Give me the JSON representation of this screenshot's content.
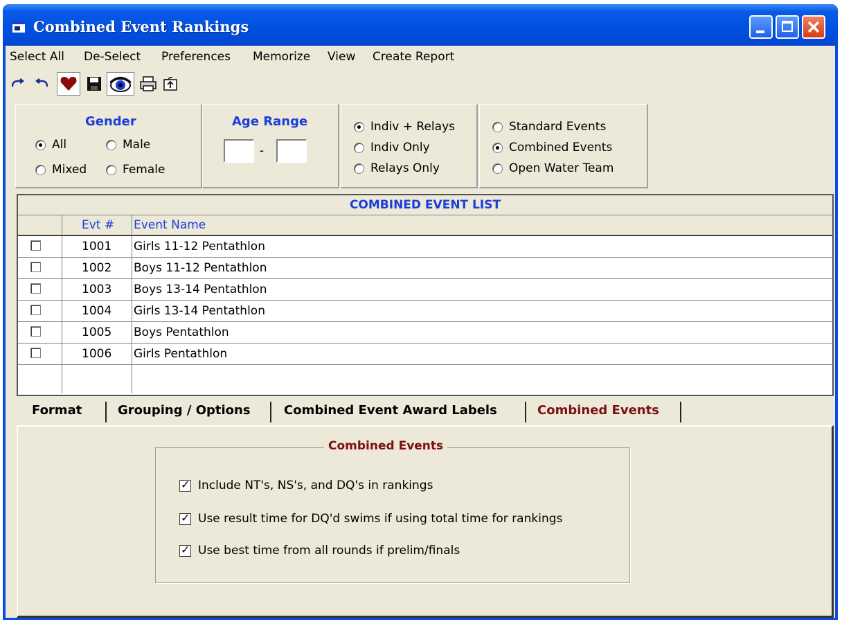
{
  "window": {
    "title": "Combined Event Rankings"
  },
  "menu": [
    "Select All",
    "De-Select",
    "Preferences",
    "Memorize",
    "View",
    "Create Report"
  ],
  "toolbar": [
    {
      "name": "redo-icon"
    },
    {
      "name": "undo-icon"
    },
    {
      "name": "heart-icon"
    },
    {
      "name": "save-icon"
    },
    {
      "name": "eye-icon"
    },
    {
      "name": "print-icon"
    },
    {
      "name": "export-icon"
    }
  ],
  "gender": {
    "label": "Gender",
    "options": [
      {
        "label": "All",
        "selected": true
      },
      {
        "label": "Male",
        "selected": false
      },
      {
        "label": "Mixed",
        "selected": false
      },
      {
        "label": "Female",
        "selected": false
      }
    ]
  },
  "age_range": {
    "label": "Age Range",
    "from": "",
    "to": "",
    "separator": "-"
  },
  "event_type": {
    "options": [
      {
        "label": "Indiv + Relays",
        "selected": true
      },
      {
        "label": "Indiv Only",
        "selected": false
      },
      {
        "label": "Relays Only",
        "selected": false
      }
    ]
  },
  "event_category": {
    "options": [
      {
        "label": "Standard Events",
        "selected": false
      },
      {
        "label": "Combined Events",
        "selected": true
      },
      {
        "label": "Open Water Team",
        "selected": false
      }
    ]
  },
  "event_list": {
    "title": "COMBINED EVENT LIST",
    "columns": [
      "",
      "Evt #",
      "Event Name"
    ],
    "rows": [
      {
        "checked": false,
        "evt": "1001",
        "name": "Girls 11-12 Pentathlon"
      },
      {
        "checked": false,
        "evt": "1002",
        "name": "Boys 11-12 Pentathlon"
      },
      {
        "checked": false,
        "evt": "1003",
        "name": "Boys 13-14 Pentathlon"
      },
      {
        "checked": false,
        "evt": "1004",
        "name": "Girls 13-14 Pentathlon"
      },
      {
        "checked": false,
        "evt": "1005",
        "name": "Boys  Pentathlon"
      },
      {
        "checked": false,
        "evt": "1006",
        "name": "Girls  Pentathlon"
      }
    ]
  },
  "tabs": [
    {
      "label": "Format",
      "active": false
    },
    {
      "label": "Grouping / Options",
      "active": false
    },
    {
      "label": "Combined Event Award Labels",
      "active": false
    },
    {
      "label": "Combined Events",
      "active": true
    }
  ],
  "combined_events_panel": {
    "legend": "Combined Events",
    "options": [
      {
        "label": "Include NT's, NS's, and DQ's in rankings",
        "checked": true
      },
      {
        "label": "Use result time for DQ'd swims if using total time for rankings",
        "checked": true
      },
      {
        "label": "Use best time from all rounds if prelim/finals",
        "checked": true
      }
    ]
  },
  "colors": {
    "titlebar": "#0050e0",
    "face": "#ece9d8",
    "label_blue": "#1a3ddb",
    "label_maroon": "#7b1010"
  }
}
